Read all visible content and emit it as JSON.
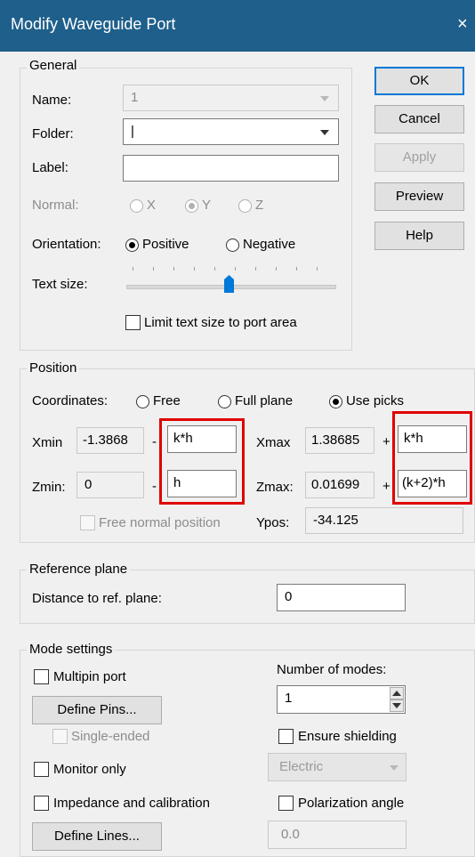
{
  "window": {
    "title": "Modify Waveguide Port",
    "close_glyph": "×"
  },
  "buttons": {
    "ok": "OK",
    "cancel": "Cancel",
    "apply": "Apply",
    "preview": "Preview",
    "help": "Help"
  },
  "general": {
    "title": "General",
    "name_label": "Name:",
    "name_value": "1",
    "folder_label": "Folder:",
    "folder_value": "|",
    "label_label": "Label:",
    "label_value": "",
    "normal_label": "Normal:",
    "normal_options": [
      "X",
      "Y",
      "Z"
    ],
    "normal_selected": "Y",
    "orientation_label": "Orientation:",
    "orientation_options": [
      "Positive",
      "Negative"
    ],
    "orientation_selected": "Positive",
    "textsize_label": "Text size:",
    "textsize_level_fraction": 0.5,
    "limit_label": "Limit text size to port area",
    "limit_checked": false
  },
  "position": {
    "title": "Position",
    "coordinates_label": "Coordinates:",
    "coord_options": [
      "Free",
      "Full plane",
      "Use picks"
    ],
    "coord_selected": "Use picks",
    "xmin_label": "Xmin",
    "xmin_value": "-1.3868",
    "xmin_sign": "-",
    "xmin_offset": "k*h",
    "xmax_label": "Xmax",
    "xmax_value": "1.38685",
    "xmax_sign": "+",
    "xmax_offset": "k*h",
    "zmin_label": "Zmin:",
    "zmin_value": "0",
    "zmin_sign": "-",
    "zmin_offset": "h",
    "zmax_label": "Zmax:",
    "zmax_value": "0.01699",
    "zmax_sign": "+",
    "zmax_offset": "(k+2)*h",
    "free_normal_label": "Free normal position",
    "free_normal_checked": false,
    "ypos_label": "Ypos:",
    "ypos_value": "-34.125"
  },
  "reference": {
    "title": "Reference plane",
    "distance_label": "Distance to ref. plane:",
    "distance_value": "0"
  },
  "mode": {
    "title": "Mode settings",
    "multipin_label": "Multipin port",
    "multipin_checked": false,
    "define_pins": "Define Pins...",
    "single_ended_label": "Single-ended",
    "single_ended_checked": false,
    "monitor_label": "Monitor only",
    "monitor_checked": false,
    "impedance_label": "Impedance and calibration",
    "impedance_checked": false,
    "define_lines": "Define Lines...",
    "num_modes_label": "Number of modes:",
    "num_modes_value": "1",
    "ensure_shielding_label": "Ensure shielding",
    "ensure_shielding_checked": false,
    "shielding_select": "Electric",
    "polarization_label": "Polarization angle",
    "polarization_checked": false,
    "polarization_value": "0.0"
  },
  "colors": {
    "titlebar": "#1f5f8b",
    "highlight": "#e00000",
    "accent": "#0078d7",
    "slider_thumb": "#0078d7"
  }
}
